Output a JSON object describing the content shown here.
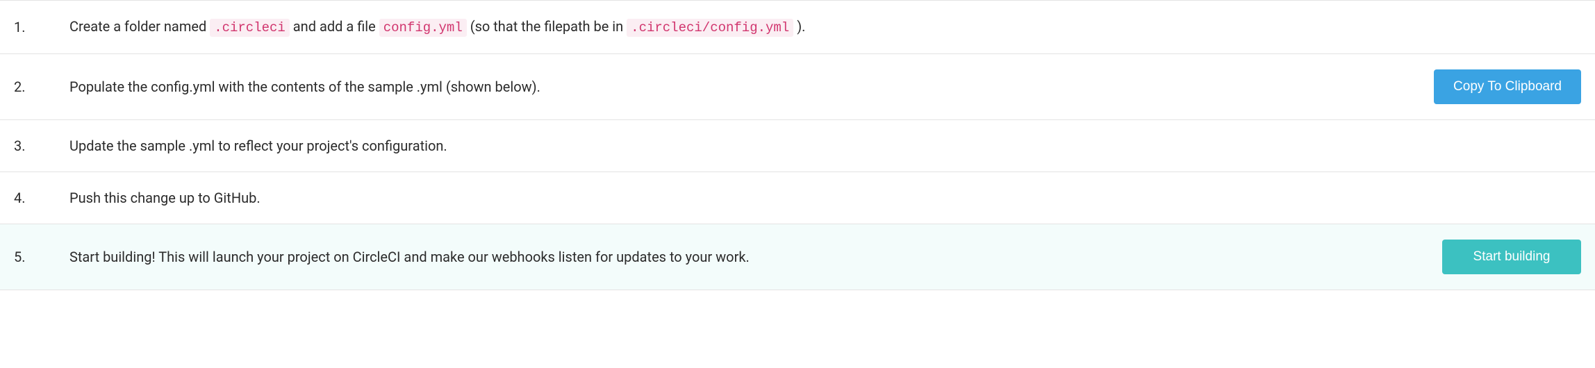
{
  "steps": [
    {
      "num": "1.",
      "prefix": "Create a folder named ",
      "code1": ".circleci",
      "mid": " and add a file ",
      "code2": "config.yml",
      "mid2": " (so that the filepath be in ",
      "code3": ".circleci/config.yml",
      "suffix": ")."
    },
    {
      "num": "2.",
      "text": "Populate the config.yml with the contents of the sample .yml (shown below).",
      "button": "Copy To Clipboard"
    },
    {
      "num": "3.",
      "text": "Update the sample .yml to reflect your project's configuration."
    },
    {
      "num": "4.",
      "text": "Push this change up to GitHub."
    },
    {
      "num": "5.",
      "text": "Start building! This will launch your project on CircleCI and make our webhooks listen for updates to your work.",
      "button": "Start building"
    }
  ]
}
